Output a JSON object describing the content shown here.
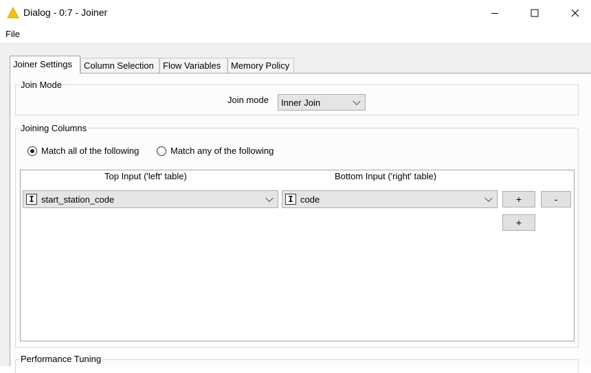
{
  "window": {
    "title": "Dialog - 0:7 - Joiner"
  },
  "menu": {
    "file": "File"
  },
  "tabs": [
    {
      "label": "Joiner Settings",
      "active": true
    },
    {
      "label": "Column Selection",
      "active": false
    },
    {
      "label": "Flow Variables",
      "active": false
    },
    {
      "label": "Memory Policy",
      "active": false
    }
  ],
  "join_mode_group": {
    "title": "Join Mode",
    "label": "Join mode",
    "selected": "Inner Join"
  },
  "joining_columns_group": {
    "title": "Joining Columns",
    "radio_all": "Match all of the following",
    "radio_any": "Match any of the following",
    "selected": "all",
    "top_header": "Top Input ('left' table)",
    "bottom_header": "Bottom Input ('right' table)",
    "row": {
      "left_type": "I",
      "left_value": "start_station_code",
      "right_type": "I",
      "right_value": "code"
    },
    "add_label": "+",
    "remove_label": "-"
  },
  "performance_group": {
    "title": "Performance Tuning"
  },
  "colors": {
    "warning": "#f5c400",
    "dialog_bg": "#f0f0f0",
    "panel_bg": "#fcfcfc"
  }
}
